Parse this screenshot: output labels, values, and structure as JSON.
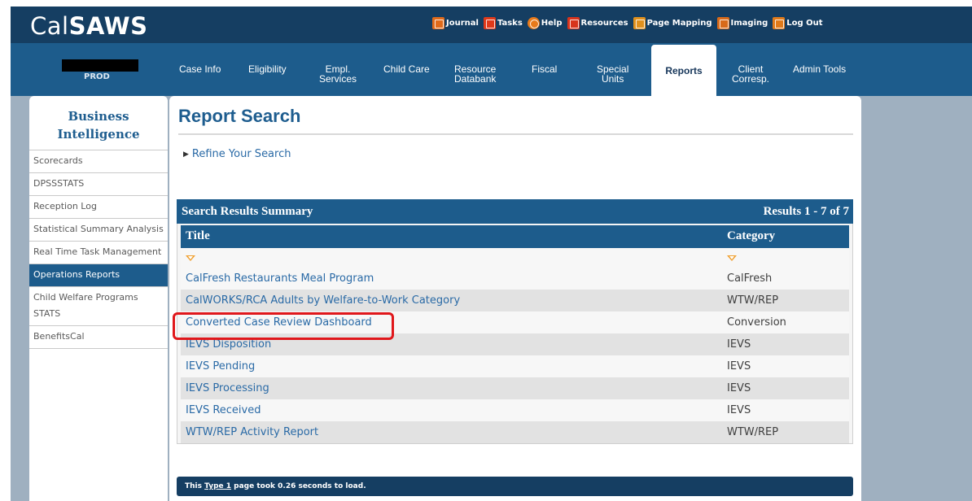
{
  "app": {
    "logo_prefix": "Cal",
    "logo_bold": "SAWS",
    "environment": "PROD"
  },
  "toplinks": [
    {
      "label": "Journal",
      "icon": "journal-icon"
    },
    {
      "label": "Tasks",
      "icon": "tasks-icon"
    },
    {
      "label": "Help",
      "icon": "help-icon"
    },
    {
      "label": "Resources",
      "icon": "resources-icon"
    },
    {
      "label": "Page Mapping",
      "icon": "page-mapping-icon"
    },
    {
      "label": "Imaging",
      "icon": "imaging-icon"
    },
    {
      "label": "Log Out",
      "icon": "logout-icon"
    }
  ],
  "nav": {
    "case_info": "Case Info",
    "eligibility": "Eligibility",
    "empl_1": "Empl.",
    "empl_2": "Services",
    "child_care": "Child Care",
    "resource_1": "Resource",
    "resource_2": "Databank",
    "fiscal": "Fiscal",
    "special_1": "Special",
    "special_2": "Units",
    "reports": "Reports",
    "client_1": "Client",
    "client_2": "Corresp.",
    "admin_tools": "Admin Tools"
  },
  "sidebar": {
    "title_1": "Business",
    "title_2": "Intelligence",
    "items": [
      {
        "label": "Scorecards"
      },
      {
        "label": "DPSSSTATS"
      },
      {
        "label": "Reception Log"
      },
      {
        "label": "Statistical Summary Analysis"
      },
      {
        "label": "Real Time Task Management"
      },
      {
        "label": "Operations Reports"
      },
      {
        "label": "Child Welfare Programs STATS"
      },
      {
        "label": "BenefitsCal"
      }
    ]
  },
  "main": {
    "title": "Report Search",
    "refine": "Refine Your Search",
    "summary_title": "Search Results Summary",
    "results_range": "Results 1 - 7 of 7",
    "col_title": "Title",
    "col_category": "Category",
    "rows": [
      {
        "title": "CalFresh Restaurants Meal Program",
        "category": "CalFresh"
      },
      {
        "title": "CalWORKS/RCA Adults by Welfare-to-Work Category",
        "category": "WTW/REP"
      },
      {
        "title": "Converted Case Review Dashboard",
        "category": "Conversion"
      },
      {
        "title": "IEVS Disposition",
        "category": "IEVS"
      },
      {
        "title": "IEVS Pending",
        "category": "IEVS"
      },
      {
        "title": "IEVS Processing",
        "category": "IEVS"
      },
      {
        "title": "IEVS Received",
        "category": "IEVS"
      },
      {
        "title": "WTW/REP Activity Report",
        "category": "WTW/REP"
      }
    ],
    "footer_pre": "This ",
    "footer_link": "Type 1",
    "footer_post": " page took 0.26 seconds to load."
  },
  "colors": {
    "topbar": "#153e62",
    "navband": "#1d5c8c",
    "link": "#2a6aa6",
    "highlight": "#e0171b"
  }
}
